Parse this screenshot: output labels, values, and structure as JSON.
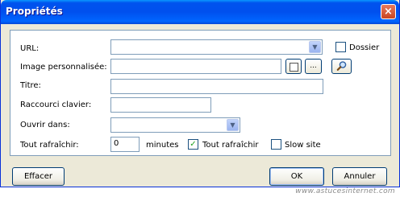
{
  "window": {
    "title": "Propriétés",
    "close_glyph": "×"
  },
  "form": {
    "url_label": "URL:",
    "url_value": "",
    "dossier_label": "Dossier",
    "dossier_checked": false,
    "image_label": "Image personnalisée:",
    "image_value": "",
    "browse_label": "...",
    "titre_label": "Titre:",
    "titre_value": "",
    "raccourci_label": "Raccourci clavier:",
    "raccourci_value": "",
    "ouvrir_label": "Ouvrir dans:",
    "ouvrir_value": "",
    "rafraichir_label": "Tout rafraîchir:",
    "minutes_value": "0",
    "minutes_label": "minutes",
    "tout_rafraichir_label": "Tout rafraîchir",
    "tout_rafraichir_checked": true,
    "slow_site_label": "Slow site",
    "slow_site_checked": false
  },
  "buttons": {
    "effacer": "Effacer",
    "ok": "OK",
    "annuler": "Annuler"
  },
  "watermark": "www.astucesinternet.com",
  "icons": {
    "combo_arrow": "chevron-down-icon",
    "image_preview": "square-icon",
    "search": "magnifier-icon",
    "check": "✓"
  }
}
